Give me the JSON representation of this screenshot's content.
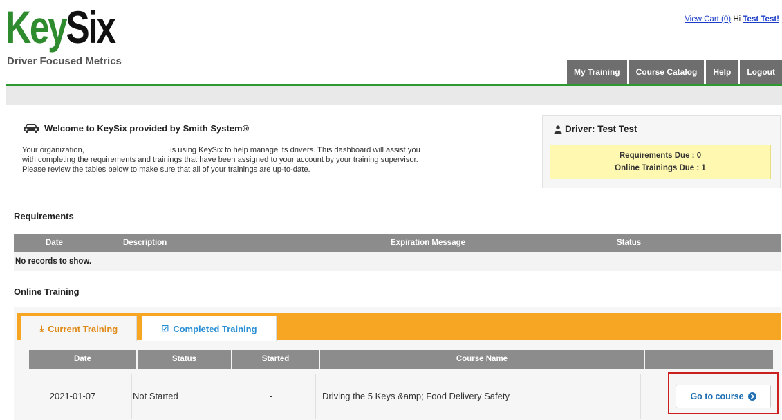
{
  "header": {
    "logo_key": "Key",
    "logo_six": "Six",
    "tagline": "Driver Focused Metrics",
    "view_cart": "View Cart (0)",
    "greeting": "Hi",
    "user_name": "Test Test!"
  },
  "nav": {
    "items": [
      "My Training",
      "Course Catalog",
      "Help",
      "Logout"
    ]
  },
  "welcome": {
    "title": "Welcome to KeySix provided by Smith System®",
    "line1": "Your organization,                                        is using KeySix to help manage its drivers. This dashboard will assist you",
    "line2": "with completing the requirements and trainings that have been assigned to your account by your training supervisor.",
    "line3": "Please review the tables below to make sure that all of your trainings are up-to-date."
  },
  "driver": {
    "title": "Driver: Test Test",
    "requirements_due": "Requirements Due : 0",
    "online_trainings_due": "Online Trainings Due : 1"
  },
  "requirements": {
    "title": "Requirements",
    "columns": [
      "Date",
      "Description",
      "Expiration Message",
      "Status"
    ],
    "empty": "No records to show."
  },
  "online_training": {
    "title": "Online Training",
    "tabs": {
      "current": "Current Training",
      "completed": "Completed Training"
    },
    "columns": [
      "Date",
      "Status",
      "Started",
      "Course Name",
      ""
    ],
    "rows": [
      {
        "date": "2021-01-07",
        "status": "Not Started",
        "started": "-",
        "course_name": "Driving the 5 Keys &amp; Food Delivery Safety",
        "action": "Go to course"
      }
    ]
  },
  "colors": {
    "brand_green": "#2e8b2e",
    "nav_grey": "#6e6e6e",
    "tab_orange": "#f6a623",
    "highlight_red": "#cc1f1f",
    "link_blue": "#1a3cc8"
  }
}
